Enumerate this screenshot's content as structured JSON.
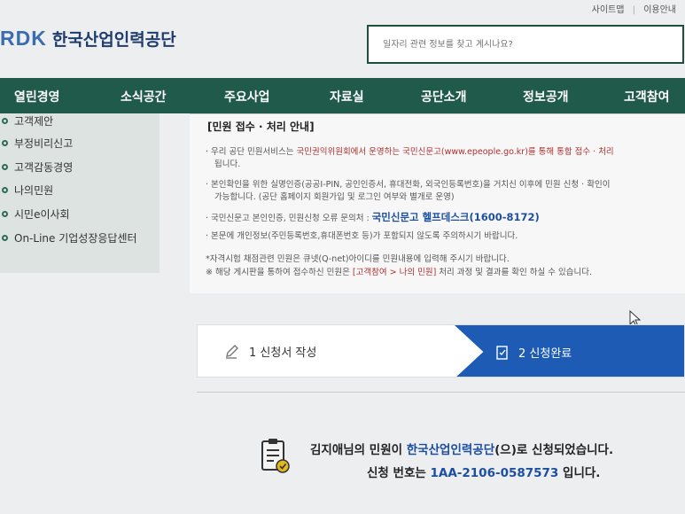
{
  "util": {
    "sitemap": "사이트맵",
    "sep": "|",
    "guide": "이용안내"
  },
  "logo": {
    "mark": "RDK",
    "name": "한국산업인력공단"
  },
  "search": {
    "placeholder": "일자리 관련 정보를 찾고 계시나요?"
  },
  "gnb": {
    "items": [
      "열린경영",
      "소식공간",
      "주요사업",
      "자료실",
      "공단소개",
      "정보공개",
      "고객참여"
    ]
  },
  "lnb": {
    "items": [
      "고객제안",
      "부정비리신고",
      "고객감동경영",
      "나의민원",
      "시민e이사회",
      "On-Line 기업성장응답센터"
    ]
  },
  "notice": {
    "title": "[민원 접수 · 처리 안내]",
    "p1a": "· 우리 공단 민원서비스는 ",
    "p1b": "국민권익위원회에서 운영하는 국민신문고(www.epeople.go.kr)를 통해 통합 접수 · 처리",
    "p1c": "됩니다.",
    "p2a": "· 본인확인을 위한 실명인증(공공I-PIN, 공인인증서, 휴대전화, 외국인등록번호)을 거치신 이후에 민원 신청 · 확인이",
    "p2b": "가능합니다. (공단 홈페이지 회원가입 및 로그인 여부와 별개로 운영)",
    "p3a": "· 국민신문고 본인인증, 민원신청 오류 문의처 : ",
    "p3b": "국민신문고 헬프데스크(1600-8172)",
    "p4": "· 본문에 개인정보(주민등록번호,휴대폰번호 등)가 포함되지 않도록 주의하시기 바랍니다.",
    "p5": "*자격시험 채점관련 민원은 큐넷(Q-net)아이디를 민원내용에 입력해 주시기 바랍니다.",
    "p6a": "※ 해당 게시판을 통하여 접수하신 민원은 ",
    "p6b": "[고객참여 > 나의 민원]",
    "p6c": " 처리 과정 및 결과를 확인 하실 수 있습니다."
  },
  "steps": {
    "step1": "1 신청서 작성",
    "step2": "2 신청완료"
  },
  "result": {
    "line1_pre": "김지애님의 민원이 ",
    "line1_em": "한국산업인력공단",
    "line1_post": "(으)로 신청되었습니다.",
    "line2_pre": "신청 번호는 ",
    "line2_em": "1AA-2106-0587573",
    "line2_post": " 입니다."
  },
  "colors": {
    "nav_green": "#1f5a4a",
    "step_blue": "#1d5bb5",
    "accent_red": "#b03030",
    "text_blue": "#1d4fa0"
  },
  "icons": [
    "pencil-icon",
    "check-document-icon",
    "document-check-icon",
    "mouse-pointer-icon"
  ]
}
